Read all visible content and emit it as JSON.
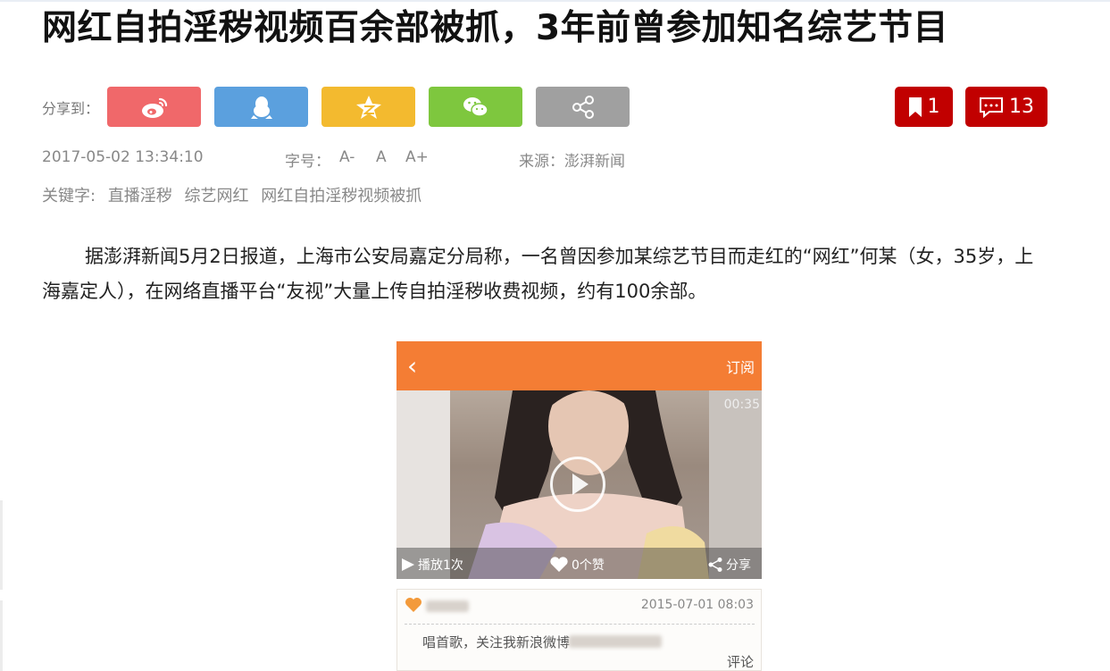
{
  "article": {
    "title": "网红自拍淫秽视频百余部被抓，3年前曾参加知名综艺节目",
    "share_label": "分享到：",
    "share_buttons": [
      {
        "name": "weibo",
        "color": "#f0686a",
        "icon": "weibo-icon"
      },
      {
        "name": "qq",
        "color": "#5ba0de",
        "icon": "qq-icon"
      },
      {
        "name": "qzone",
        "color": "#f3ba2f",
        "icon": "qzone-icon"
      },
      {
        "name": "wechat",
        "color": "#7ec73e",
        "icon": "wechat-icon"
      },
      {
        "name": "more",
        "color": "#a0a0a0",
        "icon": "share-icon"
      }
    ],
    "bookmark_count": "1",
    "comment_count": "13",
    "datetime": "2017-05-02 13:34:10",
    "font_label": "字号：",
    "font_small": "A-",
    "font_normal": "A",
    "font_large": "A+",
    "source": "来源：澎湃新闻",
    "keywords_label": "关键字:",
    "keywords": [
      "直播淫秽",
      "综艺网红",
      "网红自拍淫秽视频被抓"
    ],
    "body": "据澎湃新闻5月2日报道，上海市公安局嘉定分局称，一名曾因参加某综艺节目而走红的“网红”何某（女，35岁，上海嘉定人），在网络直播平台“友视”大量上传自拍淫秽收费视频，约有100余部。"
  },
  "embedded_image": {
    "back": "‹",
    "subscribe": "订阅",
    "duration": "00:35",
    "play_count": "播放1次",
    "likes": "0个赞",
    "share": "分享",
    "post_date": "2015-07-01 08:03",
    "post_text": "唱首歌，关注我新浪微博",
    "comment": "评论",
    "accent": "#f47d34"
  },
  "colors": {
    "accent_red": "#c10000"
  }
}
